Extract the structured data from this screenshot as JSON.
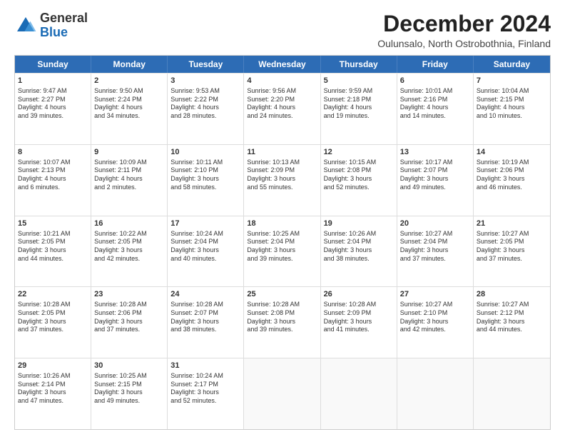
{
  "header": {
    "logo_general": "General",
    "logo_blue": "Blue",
    "title": "December 2024",
    "subtitle": "Oulunsalo, North Ostrobothnia, Finland"
  },
  "calendar": {
    "days": [
      "Sunday",
      "Monday",
      "Tuesday",
      "Wednesday",
      "Thursday",
      "Friday",
      "Saturday"
    ],
    "weeks": [
      [
        null,
        {
          "num": "2",
          "info": "Sunrise: 9:50 AM\nSunset: 2:24 PM\nDaylight: 4 hours\nand 34 minutes."
        },
        {
          "num": "3",
          "info": "Sunrise: 9:53 AM\nSunset: 2:22 PM\nDaylight: 4 hours\nand 28 minutes."
        },
        {
          "num": "4",
          "info": "Sunrise: 9:56 AM\nSunset: 2:20 PM\nDaylight: 4 hours\nand 24 minutes."
        },
        {
          "num": "5",
          "info": "Sunrise: 9:59 AM\nSunset: 2:18 PM\nDaylight: 4 hours\nand 19 minutes."
        },
        {
          "num": "6",
          "info": "Sunrise: 10:01 AM\nSunset: 2:16 PM\nDaylight: 4 hours\nand 14 minutes."
        },
        {
          "num": "7",
          "info": "Sunrise: 10:04 AM\nSunset: 2:15 PM\nDaylight: 4 hours\nand 10 minutes."
        }
      ],
      [
        {
          "num": "1",
          "info": "Sunrise: 9:47 AM\nSunset: 2:27 PM\nDaylight: 4 hours\nand 39 minutes."
        },
        {
          "num": "9",
          "info": "Sunrise: 10:09 AM\nSunset: 2:11 PM\nDaylight: 4 hours\nand 2 minutes."
        },
        {
          "num": "10",
          "info": "Sunrise: 10:11 AM\nSunset: 2:10 PM\nDaylight: 3 hours\nand 58 minutes."
        },
        {
          "num": "11",
          "info": "Sunrise: 10:13 AM\nSunset: 2:09 PM\nDaylight: 3 hours\nand 55 minutes."
        },
        {
          "num": "12",
          "info": "Sunrise: 10:15 AM\nSunset: 2:08 PM\nDaylight: 3 hours\nand 52 minutes."
        },
        {
          "num": "13",
          "info": "Sunrise: 10:17 AM\nSunset: 2:07 PM\nDaylight: 3 hours\nand 49 minutes."
        },
        {
          "num": "14",
          "info": "Sunrise: 10:19 AM\nSunset: 2:06 PM\nDaylight: 3 hours\nand 46 minutes."
        }
      ],
      [
        {
          "num": "8",
          "info": "Sunrise: 10:07 AM\nSunset: 2:13 PM\nDaylight: 4 hours\nand 6 minutes."
        },
        {
          "num": "16",
          "info": "Sunrise: 10:22 AM\nSunset: 2:05 PM\nDaylight: 3 hours\nand 42 minutes."
        },
        {
          "num": "17",
          "info": "Sunrise: 10:24 AM\nSunset: 2:04 PM\nDaylight: 3 hours\nand 40 minutes."
        },
        {
          "num": "18",
          "info": "Sunrise: 10:25 AM\nSunset: 2:04 PM\nDaylight: 3 hours\nand 39 minutes."
        },
        {
          "num": "19",
          "info": "Sunrise: 10:26 AM\nSunset: 2:04 PM\nDaylight: 3 hours\nand 38 minutes."
        },
        {
          "num": "20",
          "info": "Sunrise: 10:27 AM\nSunset: 2:04 PM\nDaylight: 3 hours\nand 37 minutes."
        },
        {
          "num": "21",
          "info": "Sunrise: 10:27 AM\nSunset: 2:05 PM\nDaylight: 3 hours\nand 37 minutes."
        }
      ],
      [
        {
          "num": "15",
          "info": "Sunrise: 10:21 AM\nSunset: 2:05 PM\nDaylight: 3 hours\nand 44 minutes."
        },
        {
          "num": "23",
          "info": "Sunrise: 10:28 AM\nSunset: 2:06 PM\nDaylight: 3 hours\nand 37 minutes."
        },
        {
          "num": "24",
          "info": "Sunrise: 10:28 AM\nSunset: 2:07 PM\nDaylight: 3 hours\nand 38 minutes."
        },
        {
          "num": "25",
          "info": "Sunrise: 10:28 AM\nSunset: 2:08 PM\nDaylight: 3 hours\nand 39 minutes."
        },
        {
          "num": "26",
          "info": "Sunrise: 10:28 AM\nSunset: 2:09 PM\nDaylight: 3 hours\nand 41 minutes."
        },
        {
          "num": "27",
          "info": "Sunrise: 10:27 AM\nSunset: 2:10 PM\nDaylight: 3 hours\nand 42 minutes."
        },
        {
          "num": "28",
          "info": "Sunrise: 10:27 AM\nSunset: 2:12 PM\nDaylight: 3 hours\nand 44 minutes."
        }
      ],
      [
        {
          "num": "22",
          "info": "Sunrise: 10:28 AM\nSunset: 2:05 PM\nDaylight: 3 hours\nand 37 minutes."
        },
        {
          "num": "30",
          "info": "Sunrise: 10:25 AM\nSunset: 2:15 PM\nDaylight: 3 hours\nand 49 minutes."
        },
        {
          "num": "31",
          "info": "Sunrise: 10:24 AM\nSunset: 2:17 PM\nDaylight: 3 hours\nand 52 minutes."
        },
        null,
        null,
        null,
        null
      ],
      [
        {
          "num": "29",
          "info": "Sunrise: 10:26 AM\nSunset: 2:14 PM\nDaylight: 3 hours\nand 47 minutes."
        },
        null,
        null,
        null,
        null,
        null,
        null
      ]
    ]
  }
}
